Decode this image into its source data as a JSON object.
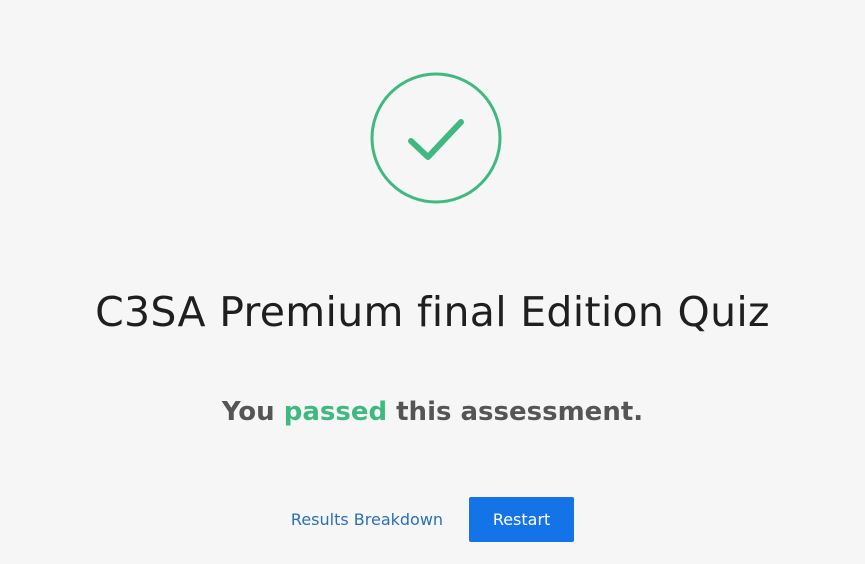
{
  "quiz": {
    "title": "C3SA Premium final Edition Quiz"
  },
  "result": {
    "prefix": "You ",
    "status": "passed",
    "suffix": " this assessment.",
    "status_color": "#3fb981"
  },
  "actions": {
    "results_breakdown_label": "Results Breakdown",
    "restart_label": "Restart"
  },
  "icons": {
    "status_icon": "checkmark-circle-icon"
  },
  "colors": {
    "accent": "#3fb981",
    "button_primary": "#1473e6",
    "link": "#2a6fb8"
  }
}
